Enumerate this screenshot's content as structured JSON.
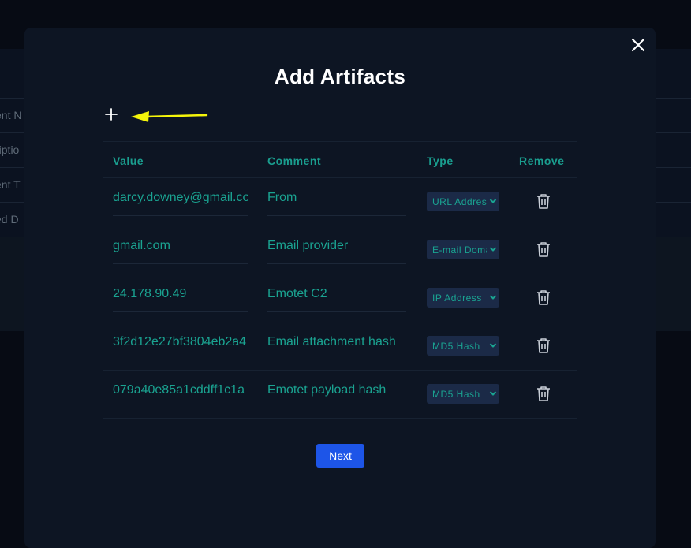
{
  "background": {
    "rows": [
      "ent N",
      "riptio",
      "ent T",
      "ed D"
    ]
  },
  "modal": {
    "title": "Add Artifacts",
    "add_icon": "plus-icon",
    "close_icon": "close-icon",
    "annotation_arrow_color": "#f5f50a",
    "columns": {
      "value": "Value",
      "comment": "Comment",
      "type": "Type",
      "remove": "Remove"
    },
    "artifacts": [
      {
        "value": "darcy.downey@gmail.com",
        "comment": "From",
        "type": "URL Address"
      },
      {
        "value": "gmail.com",
        "comment": "Email provider",
        "type": "E-mail Domain"
      },
      {
        "value": "24.178.90.49",
        "comment": "Emotet C2",
        "type": "IP Address"
      },
      {
        "value": "3f2d12e27bf3804eb2a4",
        "comment": "Email attachment hash",
        "type": "MD5 Hash"
      },
      {
        "value": "079a40e85a1cddff1c1a",
        "comment": "Emotet payload hash",
        "type": "MD5 Hash"
      }
    ],
    "next_label": "Next"
  },
  "colors": {
    "accent_teal": "#1a9e8f",
    "button_blue": "#1d55e8",
    "modal_bg": "#0d1523"
  }
}
